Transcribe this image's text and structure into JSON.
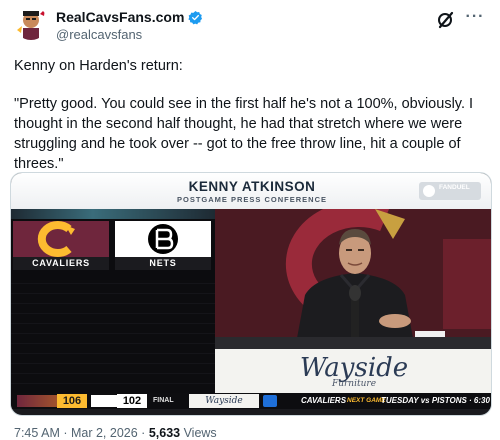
{
  "author": {
    "display_name": "RealCavsFans.com",
    "handle": "@realcavsfans",
    "verified": true
  },
  "actions": {
    "grok_icon": "grok-icon",
    "more_label": "···"
  },
  "tweet": {
    "intro": "Kenny on Harden's return:",
    "quote": "\"Pretty good. You could see in the first half he's not a 100%, obviously. I thought in the second half thought, he had that stretch where we were struggling and he took over -- got to the free throw line, hit a couple of threes.\""
  },
  "media": {
    "banner_title": "KENNY ATKINSON",
    "banner_subtitle": "POSTGAME PRESS CONFERENCE",
    "banner_logo_text": "FANDUEL",
    "team_left": "CAVALIERS",
    "team_right": "NETS",
    "sponsor_name": "Wayside",
    "sponsor_sub": "Furniture",
    "ticker": {
      "cavs_score": "106",
      "nets_score": "102",
      "status": "FINAL",
      "sponsor": "Wayside",
      "next_team": "CAVALIERS",
      "next_label": "NEXT GAME",
      "next_game": "TUESDAY vs PISTONS · 6:30"
    }
  },
  "meta": {
    "time": "7:45 AM",
    "separator": " · ",
    "date": "Mar 2, 2026",
    "views_count": "5,633",
    "views_label": " Views"
  },
  "colors": {
    "verified": "#1d9bf0",
    "cavs_wine": "#6f263d",
    "cavs_gold": "#fdbb30",
    "text_secondary": "#536471"
  }
}
